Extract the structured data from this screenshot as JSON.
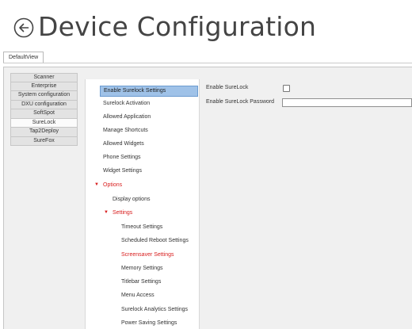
{
  "header": {
    "title": "Device Configuration",
    "back_icon": "circled-left-arrow-icon"
  },
  "tab": {
    "label": "DefaultView"
  },
  "sidebar": {
    "items": [
      {
        "label": "Scanner"
      },
      {
        "label": "Enterprise"
      },
      {
        "label": "System configuration"
      },
      {
        "label": "DXU configuration"
      },
      {
        "label": "SoftSpot"
      },
      {
        "label": "SureLock"
      },
      {
        "label": "Tap2Deploy"
      },
      {
        "label": "SureFox"
      }
    ],
    "active_item": "SureLock"
  },
  "tree": {
    "items": [
      {
        "label": "Enable Surelock Settings",
        "selected": true
      },
      {
        "label": "Surelock Activation"
      },
      {
        "label": "Allowed Application"
      },
      {
        "label": "Manage Shortcuts"
      },
      {
        "label": "Allowed Widgets"
      },
      {
        "label": "Phone Settings"
      },
      {
        "label": "Widget Settings"
      },
      {
        "label": "Options",
        "expanded": true,
        "highlight_color": "#d81e1e"
      },
      {
        "label": "Display options"
      },
      {
        "label": "Settings",
        "expanded": true,
        "highlight_color": "#d81e1e"
      },
      {
        "label": "Timeout Settings"
      },
      {
        "label": "Scheduled Reboot Settings"
      },
      {
        "label": "Screensaver Settings",
        "highlight_color": "#d81e1e"
      },
      {
        "label": "Memory Settings"
      },
      {
        "label": "Titlebar Settings"
      },
      {
        "label": "Menu Access"
      },
      {
        "label": "Surelock Analytics Settings"
      },
      {
        "label": "Power Saving Settings"
      }
    ]
  },
  "settings": {
    "enable_surelock_label": "Enable SureLock",
    "enable_surelock_checked": false,
    "password_label": "Enable SureLock Password",
    "password_value": ""
  },
  "colors": {
    "selection": "#9fc2e8",
    "accent_red": "#d81e1e"
  }
}
